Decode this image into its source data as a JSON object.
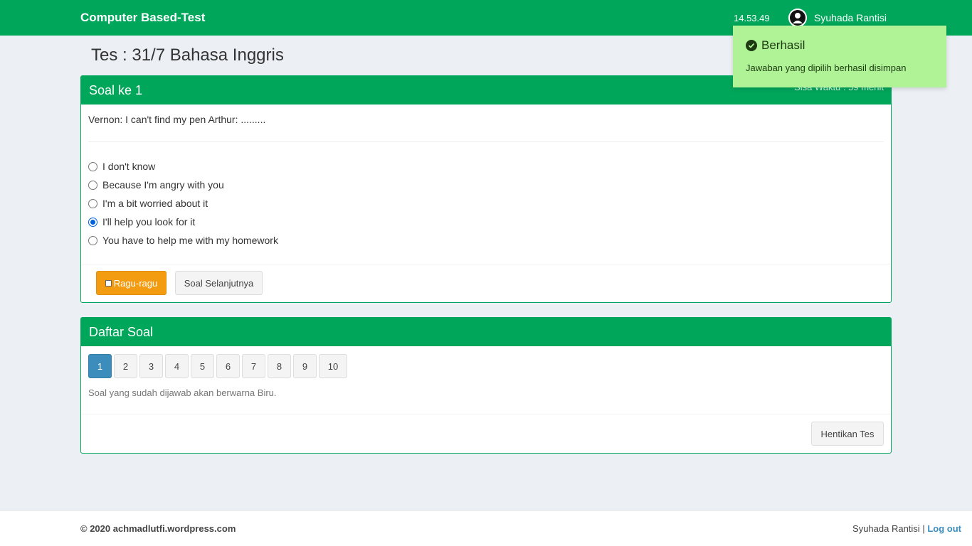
{
  "navbar": {
    "brand": "Computer Based-Test",
    "clock": "14.53.49",
    "username": "Syuhada Rantisi"
  },
  "page": {
    "title": "Tes : 31/7 Bahasa Inggris"
  },
  "question_box": {
    "header": "Soal ke 1",
    "timer": "Sisa Waktu : 59 menit",
    "question": "Vernon: I can't find my pen Arthur: .........",
    "options": [
      {
        "label": "I don't know",
        "selected": false
      },
      {
        "label": "Because I'm angry with you",
        "selected": false
      },
      {
        "label": "I'm a bit worried about it",
        "selected": false
      },
      {
        "label": "I'll help you look for it",
        "selected": true
      },
      {
        "label": "You have to help me with my homework",
        "selected": false
      }
    ],
    "ragu_label": "Ragu-ragu",
    "next_label": "Soal Selanjutnya"
  },
  "list_box": {
    "header": "Daftar Soal",
    "numbers": [
      "1",
      "2",
      "3",
      "4",
      "5",
      "6",
      "7",
      "8",
      "9",
      "10"
    ],
    "active": "1",
    "hint": "Soal yang sudah dijawab akan berwarna Biru.",
    "stop_label": "Hentikan Tes"
  },
  "footer": {
    "copyright": "© 2020 achmadlutfi.wordpress.com",
    "user": "Syuhada Rantisi",
    "separator": "|",
    "logout": "Log out"
  },
  "toast": {
    "title": "Berhasil",
    "message": "Jawaban yang dipilih berhasil disimpan"
  },
  "colors": {
    "primary": "#00a65a",
    "warning": "#f39c12",
    "active_number": "#3c8dbc",
    "toast_bg": "#b0f396"
  }
}
